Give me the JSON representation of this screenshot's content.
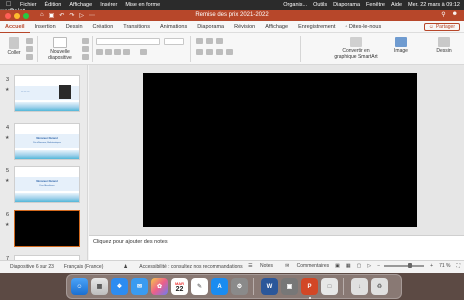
{
  "menubar": {
    "app_name": "PowerPoint",
    "items": [
      "Fichier",
      "Édition",
      "Affichage",
      "Insérer",
      "Mise en forme"
    ],
    "right_items": [
      "Organis...",
      "Outils",
      "Diaporama",
      "Fenêtre",
      "Aide"
    ],
    "clock": "Mer. 22 mars à 09:12"
  },
  "window": {
    "title": "Remise des prix 2021-2022",
    "close_color": "#ff5f57",
    "min_color": "#febc2e",
    "max_color": "#28c840",
    "accent": "#b7472a"
  },
  "ribbon_tabs": [
    "Accueil",
    "Insertion",
    "Dessin",
    "Création",
    "Transitions",
    "Animations",
    "Diaporama",
    "Révision",
    "Affichage",
    "Enregistrement",
    "Dites-le-nous"
  ],
  "share_label": "Partager",
  "ribbon": {
    "paste_label": "Coller",
    "new_slide_label": "Nouvelle diapositive",
    "convert_label": "Convertir en graphique SmartArt",
    "image_label": "Image",
    "designer_label": "Dessin"
  },
  "slides": [
    {
      "num": "3",
      "title": "",
      "subtitle": ""
    },
    {
      "num": "4",
      "title": "Monsieur Durand",
      "subtitle": "Prix d'Honneur, Mathématiques"
    },
    {
      "num": "5",
      "title": "Monsieur Durand",
      "subtitle": "Prix d'Excellence"
    },
    {
      "num": "6",
      "title": "",
      "subtitle": ""
    },
    {
      "num": "7",
      "title": "",
      "subtitle": ""
    }
  ],
  "notes_placeholder": "Cliquez pour ajouter des notes",
  "status": {
    "slide_info": "Diapositive 6 sur 23",
    "language": "Français (France)",
    "accessibility": "Accessibilité : consultez nos recommandations",
    "notes": "Notes",
    "comments": "Commentaires",
    "zoom": "71 %"
  },
  "dock": {
    "calendar_month": "MAR",
    "calendar_day": "22"
  }
}
